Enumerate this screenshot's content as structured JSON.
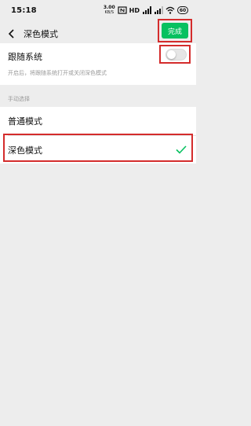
{
  "status_bar": {
    "time": "15:18",
    "net_speed": "3.00",
    "net_speed_unit": "KB/S",
    "hd": "HD",
    "battery": "60"
  },
  "header": {
    "title": "深色模式",
    "done_label": "完成"
  },
  "follow_system": {
    "label": "跟随系统",
    "description": "开启后，将跟随系统打开或关闭深色模式",
    "enabled": false
  },
  "manual_section": {
    "label": "手动选择",
    "options": [
      {
        "label": "普通模式",
        "selected": false
      },
      {
        "label": "深色模式",
        "selected": true
      }
    ]
  },
  "colors": {
    "accent": "#07c160",
    "highlight": "#d42c2c"
  }
}
